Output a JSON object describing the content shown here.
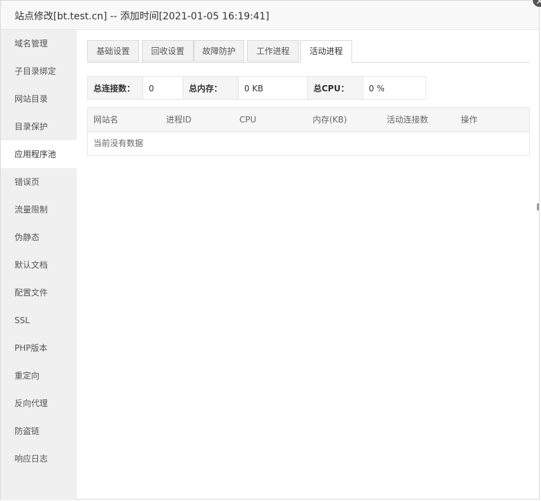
{
  "dialog": {
    "title": "站点修改[bt.test.cn] -- 添加时间[2021-01-05 16:19:41]",
    "close_label": "×"
  },
  "sidebar": {
    "items": [
      {
        "label": "域名管理"
      },
      {
        "label": "子目录绑定"
      },
      {
        "label": "网站目录"
      },
      {
        "label": "目录保护"
      },
      {
        "label": "应用程序池",
        "active": true
      },
      {
        "label": "错误页"
      },
      {
        "label": "流量限制"
      },
      {
        "label": "伪静态"
      },
      {
        "label": "默认文档"
      },
      {
        "label": "配置文件"
      },
      {
        "label": "SSL"
      },
      {
        "label": "PHP版本"
      },
      {
        "label": "重定向"
      },
      {
        "label": "反向代理"
      },
      {
        "label": "防盗链"
      },
      {
        "label": "响应日志"
      }
    ]
  },
  "tabs": [
    {
      "label": "基础设置"
    },
    {
      "label": "回收设置"
    },
    {
      "label": "故障防护"
    },
    {
      "label": "工作进程"
    },
    {
      "label": "活动进程",
      "active": true
    }
  ],
  "stats": {
    "connections_label": "总连接数：",
    "connections_value": "0",
    "memory_label": "总内存：",
    "memory_value": "0 KB",
    "cpu_label": "总CPU：",
    "cpu_value": "0 %"
  },
  "table": {
    "columns": [
      "网站名",
      "进程ID",
      "CPU",
      "内存(KB)",
      "活动连接数",
      "操作"
    ],
    "empty_text": "当前没有数据"
  }
}
